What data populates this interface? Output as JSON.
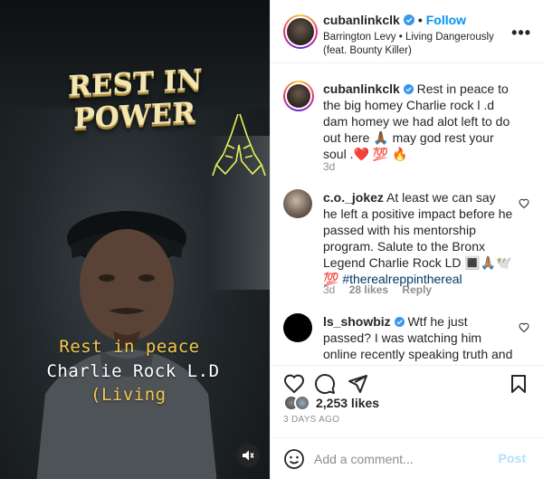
{
  "media": {
    "overlay_title": "REST IN POWER",
    "caption_lines": [
      "Rest in peace",
      "Charlie Rock L.D",
      "(Living"
    ],
    "mute_icon": "speaker-muted-icon",
    "hands_icon": "praying-hands-icon"
  },
  "header": {
    "username": "cubanlinkclk",
    "separator": "•",
    "follow_label": "Follow",
    "audio_line": "Barrington Levy • Living Dangerously (feat. Bounty Killer)",
    "more_icon": "more-options-icon",
    "more_glyph": "•••"
  },
  "comments": [
    {
      "username": "cubanlinkclk",
      "text": "Rest in peace to the big homey Charlie rock l .d dam homey we had alot left to do out here 🙏🏾 may god rest your soul .❤️ 💯 🔥",
      "time": "3d"
    },
    {
      "username": "c.o._jokez",
      "text": "At least we can say he left a positive impact before he passed with his mentorship program. Salute to the Bronx Legend Charlie Rock LD 🔳🙏🏽🕊️ 💯",
      "hashtag": "#therealreppinthereal",
      "time": "3d",
      "likes": "28 likes",
      "reply": "Reply"
    },
    {
      "username": "ls_showbiz",
      "text": "Wtf he just passed? I was watching him online recently speaking truth and now he gone?"
    }
  ],
  "actions": {
    "likes": "2,253 likes",
    "date": "3 DAYS AGO",
    "icons": [
      "heart-icon",
      "comment-icon",
      "share-icon",
      "bookmark-icon"
    ]
  },
  "add_comment": {
    "placeholder": "Add a comment...",
    "post_label": "Post"
  },
  "colors": {
    "follow": "#0095f6",
    "verified": "#3897f0",
    "post_disabled": "#b2dffc",
    "caption_yellow": "#f6c84b",
    "title_gold": "#f3e6b3"
  }
}
